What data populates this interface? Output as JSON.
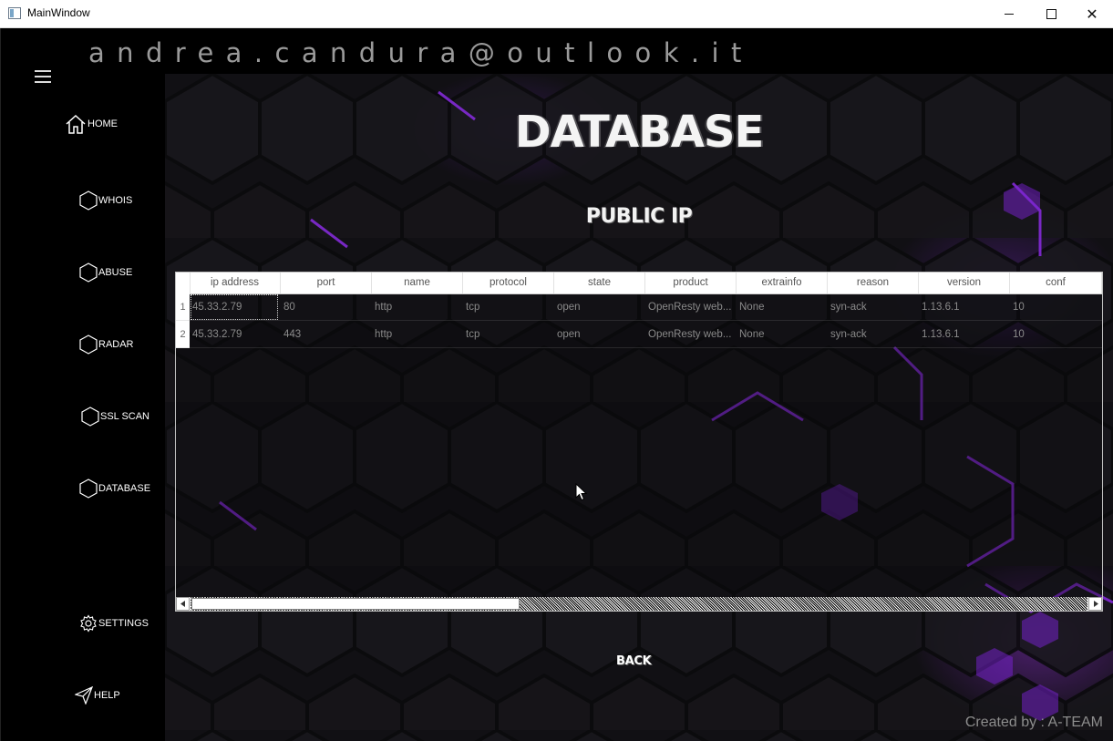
{
  "window": {
    "title": "MainWindow"
  },
  "header": {
    "email": "andrea.candura@outlook.it"
  },
  "sidebar": {
    "items": [
      {
        "label": "HOME",
        "icon": "home-icon"
      },
      {
        "label": "WHOIS",
        "icon": "hexagon-icon"
      },
      {
        "label": "ABUSE",
        "icon": "hexagon-icon"
      },
      {
        "label": "RADAR",
        "icon": "hexagon-icon"
      },
      {
        "label": "SSL SCAN",
        "icon": "hexagon-icon"
      },
      {
        "label": "DATABASE",
        "icon": "hexagon-icon"
      },
      {
        "label": "SETTINGS",
        "icon": "gear-icon"
      },
      {
        "label": "HELP",
        "icon": "send-icon"
      }
    ]
  },
  "main": {
    "title": "DATABASE",
    "subtitle": "PUBLIC IP",
    "back_label": "BACK",
    "credits": "Created by : A-TEAM"
  },
  "table": {
    "columns": [
      "ip address",
      "port",
      "name",
      "protocol",
      "state",
      "product",
      "extrainfo",
      "reason",
      "version",
      "conf"
    ],
    "row_numbers": [
      "1",
      "2"
    ],
    "rows": [
      [
        "45.33.2.79",
        "80",
        "http",
        "tcp",
        "open",
        "OpenResty web...",
        "None",
        "syn-ack",
        "1.13.6.1",
        "10"
      ],
      [
        "45.33.2.79",
        "443",
        "http",
        "tcp",
        "open",
        "OpenResty web...",
        "None",
        "syn-ack",
        "1.13.6.1",
        "10"
      ]
    ]
  },
  "colors": {
    "accent": "#8a2be2",
    "background": "#000000",
    "header_text": "#9a9a9a"
  }
}
